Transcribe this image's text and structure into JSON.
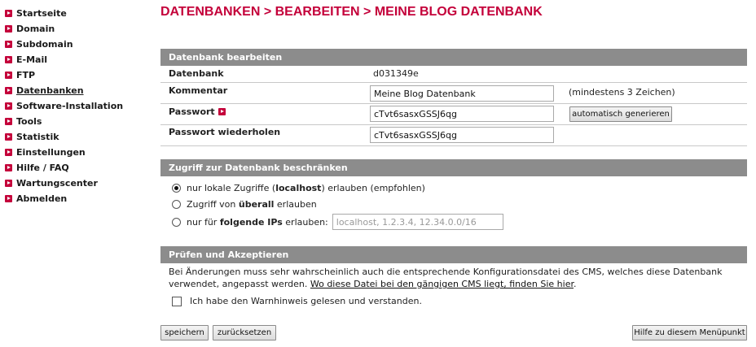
{
  "sidebar": {
    "items": [
      {
        "label": "Startseite"
      },
      {
        "label": "Domain"
      },
      {
        "label": "Subdomain"
      },
      {
        "label": "E-Mail"
      },
      {
        "label": "FTP"
      },
      {
        "label": "Datenbanken",
        "active": true
      },
      {
        "label": "Software-Installation"
      },
      {
        "label": "Tools"
      },
      {
        "label": "Statistik"
      },
      {
        "label": "Einstellungen"
      },
      {
        "label": "Hilfe / FAQ"
      },
      {
        "label": "Wartungscenter"
      },
      {
        "label": "Abmelden"
      }
    ]
  },
  "page": {
    "title": "DATENBANKEN > BEARBEITEN > MEINE BLOG DATENBANK"
  },
  "edit_section": {
    "header": "Datenbank bearbeiten",
    "database_label": "Datenbank",
    "database_value": "d031349e",
    "comment_label": "Kommentar",
    "comment_value": "Meine Blog Datenbank",
    "comment_hint": "(mindestens 3 Zeichen)",
    "password_label": "Passwort",
    "password_value": "cTvt6sasxGSSJ6qg",
    "generate_button": "automatisch generieren",
    "password_repeat_label": "Passwort wiederholen",
    "password_repeat_value": "cTvt6sasxGSSJ6qg"
  },
  "access_section": {
    "header": "Zugriff zur Datenbank beschränken",
    "option_local_pre": "nur lokale Zugriffe (",
    "option_local_bold": "localhost",
    "option_local_post": ") erlauben (empfohlen)",
    "option_everywhere_pre": "Zugriff von ",
    "option_everywhere_bold": "überall",
    "option_everywhere_post": " erlauben",
    "option_ips_pre": "nur für ",
    "option_ips_bold": "folgende IPs",
    "option_ips_post": " erlauben:",
    "ips_placeholder": "localhost, 1.2.3.4, 12.34.0.0/16",
    "selected": "local"
  },
  "confirm_section": {
    "header": "Prüfen und Akzeptieren",
    "warning_text": "Bei Änderungen muss sehr wahrscheinlich auch die entsprechende Konfigurationsdatei des CMS, welches diese Datenbank verwendet, angepasst werden. ",
    "warning_link": "Wo diese Datei bei den gängigen CMS liegt, finden Sie hier",
    "warning_end": ".",
    "checkbox_label": "Ich habe den Warnhinweis gelesen und verstanden.",
    "checkbox_checked": false
  },
  "footer": {
    "save_button": "speichern",
    "reset_button": "zurücksetzen",
    "help_button": "Hilfe zu diesem Menüpunkt"
  },
  "colors": {
    "accent": "#c4003a",
    "section_header": "#8c8c8c"
  }
}
